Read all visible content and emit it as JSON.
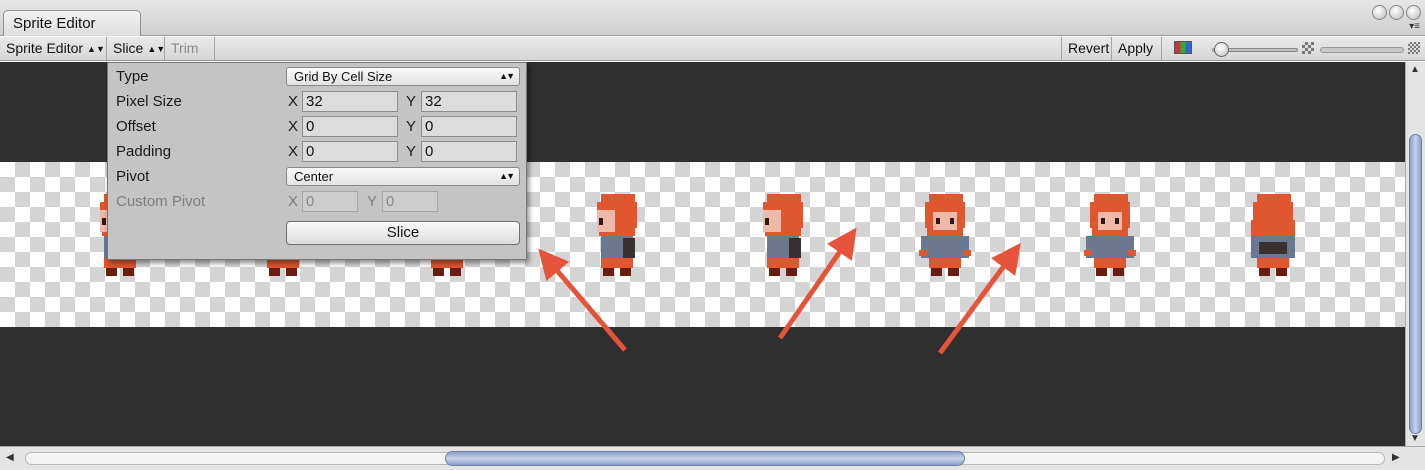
{
  "window": {
    "tab_title": "Sprite Editor",
    "tab_menu_glyph": "▾≡"
  },
  "toolbar": {
    "sprite_editor_label": "Sprite Editor",
    "slice_label": "Slice",
    "trim_label": "Trim",
    "revert_label": "Revert",
    "apply_label": "Apply",
    "zoom_level": 0.05
  },
  "slice_popup": {
    "type_label": "Type",
    "type_value": "Grid By Cell Size",
    "pixel_size_label": "Pixel Size",
    "pixel_size_x": "32",
    "pixel_size_y": "32",
    "offset_label": "Offset",
    "offset_x": "0",
    "offset_y": "0",
    "padding_label": "Padding",
    "padding_x": "0",
    "padding_y": "0",
    "pivot_label": "Pivot",
    "pivot_value": "Center",
    "custom_pivot_label": "Custom Pivot",
    "custom_pivot_x": "0",
    "custom_pivot_y": "0",
    "axis_x": "X",
    "axis_y": "Y",
    "slice_button_label": "Slice"
  },
  "sprites": {
    "count": 8,
    "facings": [
      "left",
      "left",
      "left",
      "left",
      "left",
      "front",
      "front",
      "back"
    ]
  },
  "colors": {
    "canvas_bg": "#2f2f2f",
    "hair": "#e0562f",
    "shirt": "#6b7890",
    "annotation_arrow": "#e4533a"
  }
}
